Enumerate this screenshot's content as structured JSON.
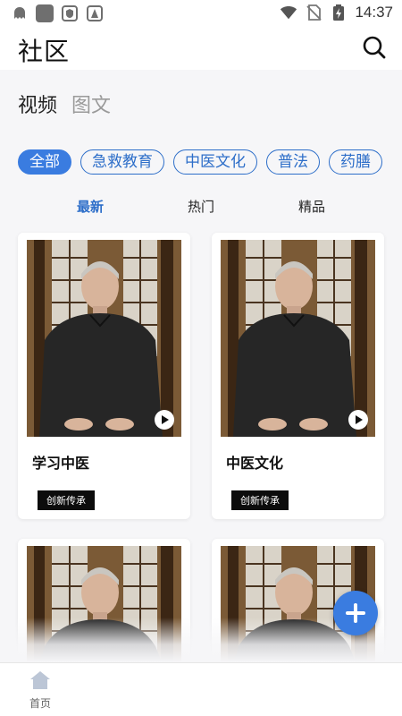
{
  "status_bar": {
    "time": "14:37",
    "left_icons": [
      "ghost-notification-icon",
      "app-square-icon",
      "shield-icon",
      "alert-icon"
    ],
    "right_icons": [
      "wifi-icon",
      "no-sim-icon",
      "battery-charging-icon"
    ]
  },
  "header": {
    "title": "社区",
    "search_icon": "search-icon"
  },
  "content_tabs": [
    {
      "label": "视频",
      "active": true
    },
    {
      "label": "图文",
      "active": false
    }
  ],
  "categories": [
    {
      "label": "全部",
      "active": true
    },
    {
      "label": "急救教育",
      "active": false
    },
    {
      "label": "中医文化",
      "active": false
    },
    {
      "label": "普法",
      "active": false
    },
    {
      "label": "药膳",
      "active": false
    }
  ],
  "sort_tabs": [
    {
      "label": "最新",
      "active": true
    },
    {
      "label": "热门",
      "active": false
    },
    {
      "label": "精品",
      "active": false
    }
  ],
  "videos": [
    {
      "title": "学习中医",
      "tag": "创新传承"
    },
    {
      "title": "中医文化",
      "tag": "创新传承"
    },
    {
      "title": "",
      "tag": ""
    },
    {
      "title": "",
      "tag": ""
    }
  ],
  "bottom_nav": {
    "home_label": "首页"
  },
  "colors": {
    "accent": "#3a7ce0",
    "background": "#f6f6f8",
    "tag_bg": "#0c0c0c"
  }
}
